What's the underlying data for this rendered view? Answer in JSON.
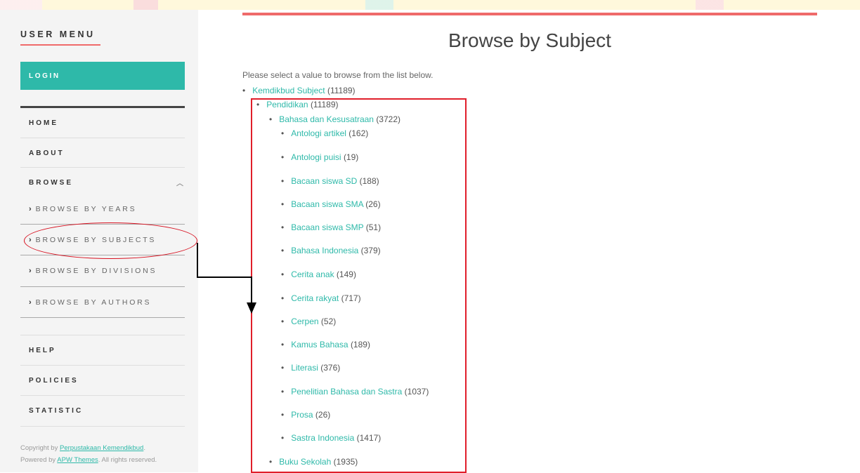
{
  "sidebar": {
    "heading": "USER MENU",
    "login": "LOGIN",
    "nav": {
      "home": "HOME",
      "about": "ABOUT",
      "browse": "BROWSE",
      "help": "HELP",
      "policies": "POLICIES",
      "statistic": "STATISTIC"
    },
    "browse_sub": {
      "years": "BROWSE BY YEARS",
      "subjects": "BROWSE BY SUBJECTS",
      "divisions": "BROWSE BY DIVISIONS",
      "authors": "BROWSE BY AUTHORS"
    },
    "footer": {
      "copyright_prefix": "Copyright by ",
      "copyright_link": "Perpustakaan Kemendikbud",
      "copyright_suffix": ".",
      "powered_prefix": "Powered by ",
      "powered_link": "APW Themes",
      "powered_suffix": ". All rights reserved."
    }
  },
  "main": {
    "title": "Browse by Subject",
    "intro": "Please select a value to browse from the list below.",
    "tree": {
      "root": {
        "label": "Kemdikbud Subject",
        "count": "(11189)"
      },
      "level1": {
        "label": "Pendidikan",
        "count": "(11189)"
      },
      "level2": {
        "label": "Bahasa dan Kesusatraan",
        "count": "(3722)"
      },
      "leaves": [
        {
          "label": "Antologi artikel",
          "count": "(162)"
        },
        {
          "label": "Antologi puisi",
          "count": "(19)"
        },
        {
          "label": "Bacaan siswa SD",
          "count": "(188)"
        },
        {
          "label": "Bacaan siswa SMA",
          "count": "(26)"
        },
        {
          "label": "Bacaan siswa SMP",
          "count": "(51)"
        },
        {
          "label": "Bahasa Indonesia",
          "count": "(379)"
        },
        {
          "label": "Cerita anak",
          "count": "(149)"
        },
        {
          "label": "Cerita rakyat",
          "count": "(717)"
        },
        {
          "label": "Cerpen",
          "count": "(52)"
        },
        {
          "label": "Kamus Bahasa",
          "count": "(189)"
        },
        {
          "label": "Literasi",
          "count": "(376)"
        },
        {
          "label": "Penelitian Bahasa dan Sastra",
          "count": "(1037)"
        },
        {
          "label": "Prosa",
          "count": "(26)"
        },
        {
          "label": "Sastra Indonesia",
          "count": "(1417)"
        }
      ],
      "next_level2": {
        "label": "Buku Sekolah",
        "count": "(1935)"
      }
    }
  },
  "colors": {
    "accent": "#2eb9a9",
    "brand_red": "#ef6a6a",
    "annotation_red": "#e01e2a"
  },
  "icons": {
    "chevron": "chevron-right-icon",
    "caret": "caret-up-icon",
    "bullet": "bullet-icon"
  }
}
